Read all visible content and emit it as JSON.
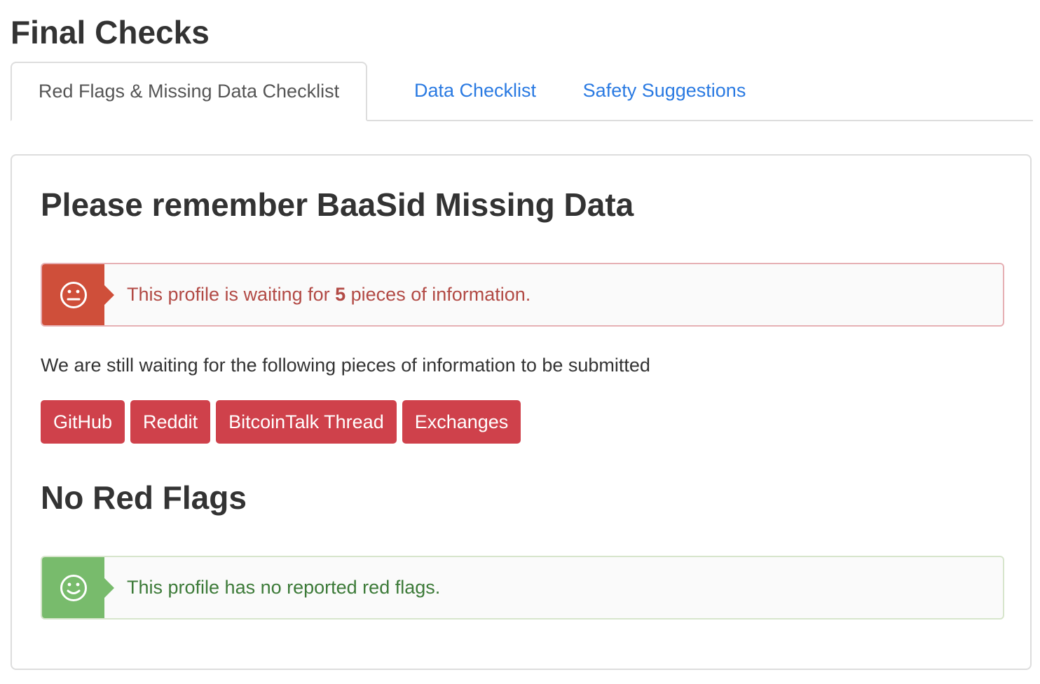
{
  "page": {
    "title": "Final Checks"
  },
  "tabs": [
    {
      "label": "Red Flags & Missing Data Checklist",
      "active": true
    },
    {
      "label": "Data Checklist",
      "active": false
    },
    {
      "label": "Safety Suggestions",
      "active": false
    }
  ],
  "missing": {
    "heading": "Please remember BaaSid Missing Data",
    "alert": {
      "icon": "neutral-face-icon",
      "text_before": "This profile is waiting for ",
      "count": "5",
      "text_after": " pieces of information."
    },
    "description": "We are still waiting for the following pieces of information to be submitted",
    "items": [
      "GitHub",
      "Reddit",
      "BitcoinTalk Thread",
      "Exchanges"
    ]
  },
  "flags": {
    "heading": "No Red Flags",
    "alert": {
      "icon": "smile-face-icon",
      "text": "This profile has no reported red flags."
    }
  },
  "colors": {
    "danger": "#cf4f3a",
    "success": "#78bb6c",
    "chip": "#cf414b",
    "link": "#2a7ae2"
  }
}
